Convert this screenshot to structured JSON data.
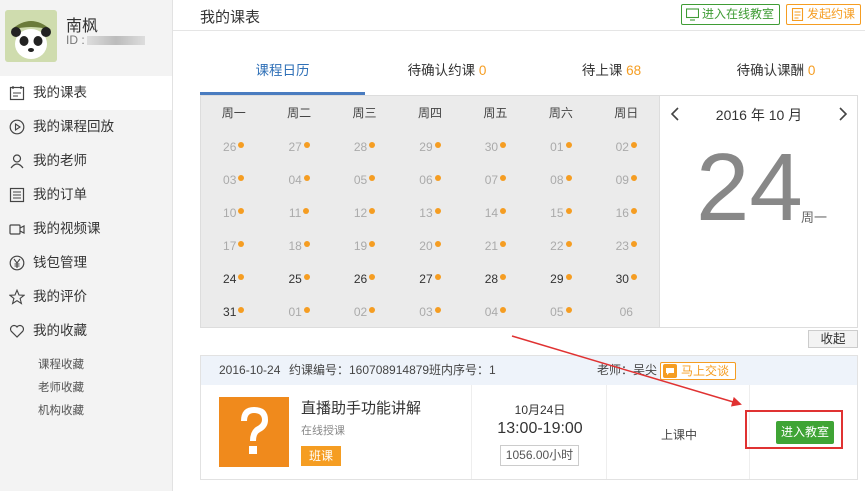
{
  "profile": {
    "name": "南枫",
    "id_label": "ID :"
  },
  "sidebar": {
    "items": [
      {
        "label": "我的课表",
        "icon": "calendar-icon"
      },
      {
        "label": "我的课程回放",
        "icon": "play-icon"
      },
      {
        "label": "我的老师",
        "icon": "user-icon"
      },
      {
        "label": "我的订单",
        "icon": "list-icon"
      },
      {
        "label": "我的视频课",
        "icon": "video-icon"
      },
      {
        "label": "钱包管理",
        "icon": "yen-icon"
      },
      {
        "label": "我的评价",
        "icon": "star-icon"
      },
      {
        "label": "我的收藏",
        "icon": "heart-icon"
      }
    ],
    "sub_items": [
      "课程收藏",
      "老师收藏",
      "机构收藏"
    ]
  },
  "header": {
    "title": "我的课表",
    "enter_classroom": "进入在线教室",
    "launch_booking": "发起约课"
  },
  "tabs": [
    {
      "label": "课程日历",
      "count": ""
    },
    {
      "label": "待确认约课",
      "count": "0"
    },
    {
      "label": "待上课",
      "count": "68"
    },
    {
      "label": "待确认课酬",
      "count": "0"
    }
  ],
  "calendar": {
    "weekdays": [
      "周一",
      "周二",
      "周三",
      "周四",
      "周五",
      "周六",
      "周日"
    ],
    "weeks": [
      [
        {
          "d": "26",
          "dot": true,
          "cur": false
        },
        {
          "d": "27",
          "dot": true,
          "cur": false
        },
        {
          "d": "28",
          "dot": true,
          "cur": false
        },
        {
          "d": "29",
          "dot": true,
          "cur": false
        },
        {
          "d": "30",
          "dot": true,
          "cur": false
        },
        {
          "d": "01",
          "dot": true,
          "cur": false
        },
        {
          "d": "02",
          "dot": true,
          "cur": false
        }
      ],
      [
        {
          "d": "03",
          "dot": true,
          "cur": false
        },
        {
          "d": "04",
          "dot": true,
          "cur": false
        },
        {
          "d": "05",
          "dot": true,
          "cur": false
        },
        {
          "d": "06",
          "dot": true,
          "cur": false
        },
        {
          "d": "07",
          "dot": true,
          "cur": false
        },
        {
          "d": "08",
          "dot": true,
          "cur": false
        },
        {
          "d": "09",
          "dot": true,
          "cur": false
        }
      ],
      [
        {
          "d": "10",
          "dot": true,
          "cur": false
        },
        {
          "d": "11",
          "dot": true,
          "cur": false
        },
        {
          "d": "12",
          "dot": true,
          "cur": false
        },
        {
          "d": "13",
          "dot": true,
          "cur": false
        },
        {
          "d": "14",
          "dot": true,
          "cur": false
        },
        {
          "d": "15",
          "dot": true,
          "cur": false
        },
        {
          "d": "16",
          "dot": true,
          "cur": false
        }
      ],
      [
        {
          "d": "17",
          "dot": true,
          "cur": false
        },
        {
          "d": "18",
          "dot": true,
          "cur": false
        },
        {
          "d": "19",
          "dot": true,
          "cur": false
        },
        {
          "d": "20",
          "dot": true,
          "cur": false
        },
        {
          "d": "21",
          "dot": true,
          "cur": false
        },
        {
          "d": "22",
          "dot": true,
          "cur": false
        },
        {
          "d": "23",
          "dot": true,
          "cur": false
        }
      ],
      [
        {
          "d": "24",
          "dot": true,
          "cur": true
        },
        {
          "d": "25",
          "dot": true,
          "cur": true
        },
        {
          "d": "26",
          "dot": true,
          "cur": true
        },
        {
          "d": "27",
          "dot": true,
          "cur": true
        },
        {
          "d": "28",
          "dot": true,
          "cur": true
        },
        {
          "d": "29",
          "dot": true,
          "cur": true
        },
        {
          "d": "30",
          "dot": true,
          "cur": true
        }
      ],
      [
        {
          "d": "31",
          "dot": true,
          "cur": true
        },
        {
          "d": "01",
          "dot": true,
          "cur": false
        },
        {
          "d": "02",
          "dot": true,
          "cur": false
        },
        {
          "d": "03",
          "dot": true,
          "cur": false
        },
        {
          "d": "04",
          "dot": true,
          "cur": false
        },
        {
          "d": "05",
          "dot": true,
          "cur": false
        },
        {
          "d": "06",
          "dot": false,
          "cur": false
        }
      ]
    ],
    "month_label": "2016 年 10 月",
    "day": "24",
    "weekday": "周一",
    "collapse": "收起"
  },
  "course": {
    "date": "2016-10-24",
    "order_no": "约课编号：160708914879",
    "class_no": "班内序号：1",
    "teacher": "老师：吴尖",
    "chat": "马上交谈",
    "title": "直播助手功能讲解",
    "subtitle": "在线授课",
    "tag": "班课",
    "time_date": "10月24日",
    "time_range": "13:00-19:00",
    "duration": "1056.00小时",
    "status": "上课中",
    "enter": "进入教室"
  },
  "colors": {
    "accent": "#f59d22",
    "green": "#3fa435",
    "blue": "#2f70b7",
    "annotation": "#e03232"
  }
}
